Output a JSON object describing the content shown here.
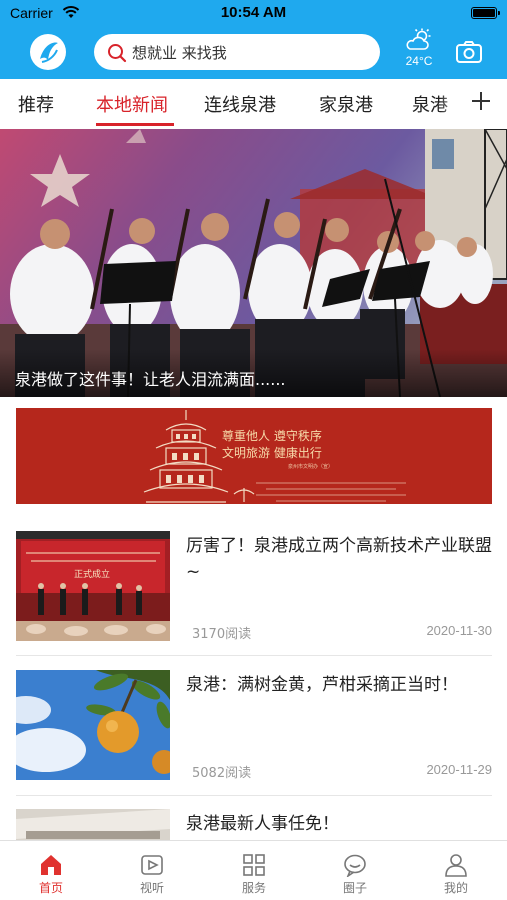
{
  "status_bar": {
    "carrier": "Carrier",
    "time": "10:54 AM"
  },
  "header": {
    "search_placeholder": "想就业 来找我",
    "weather_temp": "24°C",
    "icons": {
      "logo": "app-logo-icon",
      "search": "search-icon",
      "weather": "partly-cloudy-icon",
      "camera": "camera-icon"
    }
  },
  "tabs": [
    {
      "label": "推荐",
      "active": false
    },
    {
      "label": "本地新闻",
      "active": true
    },
    {
      "label": "连线泉港",
      "active": false
    },
    {
      "label": "家泉港",
      "active": false
    },
    {
      "label": "泉港",
      "active": false
    }
  ],
  "hero": {
    "caption": "泉港做了这件事！让老人泪流满面......"
  },
  "banner": {
    "line1": "尊重他人 遵守秩序",
    "line2": "文明旅游 健康出行",
    "sub": "泉州市文明办（宣）"
  },
  "news": [
    {
      "title": "厉害了！泉港成立两个高新技术产业联盟~",
      "reads": "3170阅读",
      "date": "2020-11-30",
      "thumb_text": "正式成立"
    },
    {
      "title": "泉港：满树金黄，芦柑采摘正当时！",
      "reads": "5082阅读",
      "date": "2020-11-29"
    },
    {
      "title": "泉港最新人事任免！"
    }
  ],
  "tab_bar": [
    {
      "label": "首页",
      "icon": "home-icon",
      "active": true
    },
    {
      "label": "视听",
      "icon": "play-icon",
      "active": false
    },
    {
      "label": "服务",
      "icon": "grid-icon",
      "active": false
    },
    {
      "label": "圈子",
      "icon": "chat-bubble-icon",
      "active": false
    },
    {
      "label": "我的",
      "icon": "user-icon",
      "active": false
    }
  ],
  "colors": {
    "brand_blue": "#1fa9ee",
    "accent_red": "#d8232a",
    "banner_red": "#b5271c"
  }
}
